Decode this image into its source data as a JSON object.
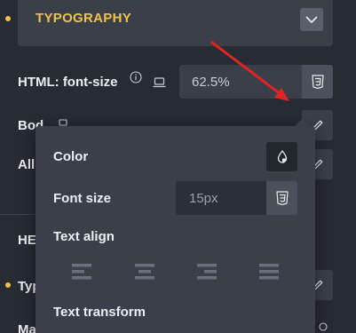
{
  "section": {
    "title": "TYPOGRAPHY"
  },
  "html_font_size": {
    "label": "HTML: font-size",
    "value": "62.5%"
  },
  "partial_rows": {
    "body": "Bod",
    "all": "All",
    "heading": "HE",
    "typo": "Typ",
    "margin": "Ma"
  },
  "popup": {
    "color_label": "Color",
    "font_size_label": "Font size",
    "font_size_placeholder": "15px",
    "text_align_label": "Text align",
    "text_transform_label": "Text transform"
  },
  "colors": {
    "accent": "#f0c24b",
    "panel": "#272b33",
    "control": "#3a3f49",
    "arrow": "#e02424"
  }
}
